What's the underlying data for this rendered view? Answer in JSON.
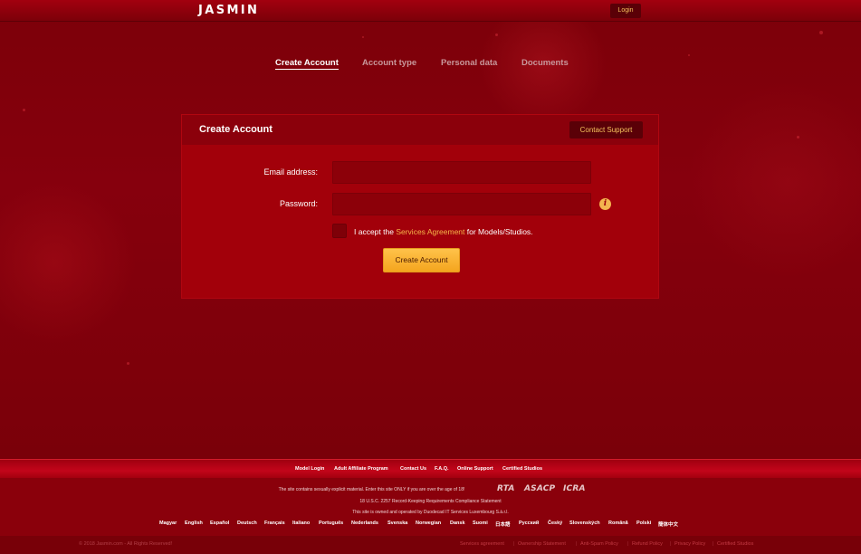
{
  "header": {
    "logo": "JASMIN",
    "login_label": "Login"
  },
  "steps": [
    {
      "label": "Create Account",
      "active": true
    },
    {
      "label": "Account type",
      "active": false
    },
    {
      "label": "Personal data",
      "active": false
    },
    {
      "label": "Documents",
      "active": false
    }
  ],
  "card": {
    "title": "Create Account",
    "support_label": "Contact Support",
    "email_label": "Email address:",
    "email_value": "",
    "password_label": "Password:",
    "password_value": "",
    "info_icon": "info-icon",
    "accept_prefix": "I accept the",
    "accept_link": "Services Agreement",
    "accept_suffix": "for Models/Studios.",
    "submit_label": "Create Account"
  },
  "footer": {
    "nav": [
      "Model Login",
      "Adult Affiliate Program",
      "Contact Us",
      "F.A.Q.",
      "Online Support",
      "Certified Studios"
    ],
    "warning": "The site contains sexually explicit material. Enter this site ONLY if you are over the age of 18!",
    "badges": [
      "RTA",
      "ASACP",
      "ICRA"
    ],
    "compliance": "18 U.S.C. 2257 Record-Keeping Requirements Compliance Statement",
    "owner": "This site is owned and operated by Duodecad IT Services Luxembourg S.à.r.l.",
    "languages": [
      "Magyar",
      "English",
      "Español",
      "Deutsch",
      "Français",
      "Italiano",
      "Português",
      "Nederlands",
      "Svenska",
      "Norwegian",
      "Dansk",
      "Suomi",
      "日本語",
      "Русский",
      "Český",
      "Slovenských",
      "Română",
      "Polski",
      "簡体中文"
    ],
    "copyright": "© 2018 Jasmin.com - All Rights Reserved!",
    "legal": [
      "Services agreement",
      "Ownership Statement",
      "Anti-Spam Policy",
      "Refund Policy",
      "Privacy Policy",
      "Certified Studios"
    ]
  },
  "colors": {
    "background": "#7a0009",
    "card": "#a2000a",
    "accent": "#f4a51e",
    "link": "#f5b64a"
  }
}
